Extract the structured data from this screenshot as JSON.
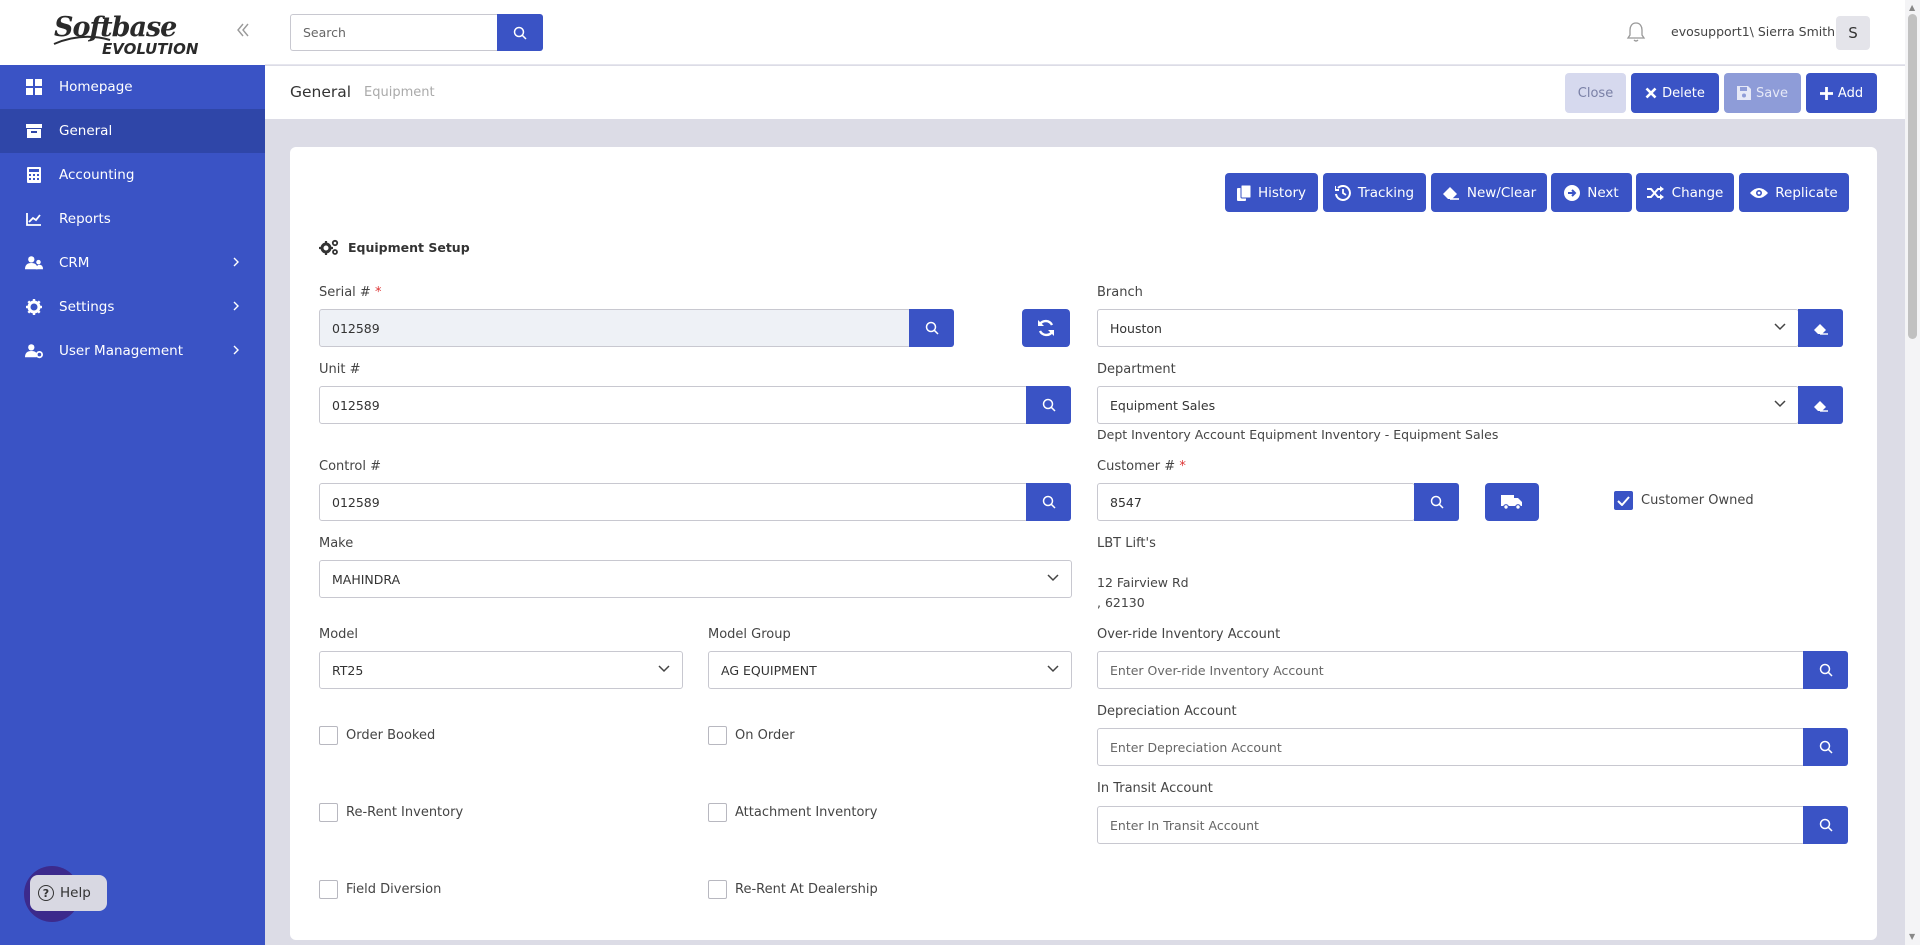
{
  "app": {
    "logo_line1": "Softbase",
    "logo_line2": "EVOLUTION"
  },
  "sidebar": {
    "items": [
      {
        "label": "Homepage",
        "icon": "grid-icon",
        "active": false
      },
      {
        "label": "General",
        "icon": "archive-icon",
        "active": true
      },
      {
        "label": "Accounting",
        "icon": "calculator-icon",
        "active": false
      },
      {
        "label": "Reports",
        "icon": "chart-icon",
        "active": false
      },
      {
        "label": "CRM",
        "icon": "users-icon",
        "active": false,
        "expandable": true
      },
      {
        "label": "Settings",
        "icon": "gear-icon",
        "active": false,
        "expandable": true
      },
      {
        "label": "User Management",
        "icon": "user-gear-icon",
        "active": false,
        "expandable": true
      }
    ],
    "help_label": "Help"
  },
  "topbar": {
    "search_placeholder": "Search",
    "username": "evosupport1\\ Sierra Smith",
    "avatar_initial": "S"
  },
  "breadcrumb": {
    "section": "General",
    "page": "Equipment"
  },
  "header_buttons": {
    "close": "Close",
    "delete": "Delete",
    "save": "Save",
    "add": "Add"
  },
  "actions": {
    "history": "History",
    "tracking": "Tracking",
    "new_clear": "New/Clear",
    "next": "Next",
    "change": "Change",
    "replicate": "Replicate"
  },
  "form": {
    "section_title": "Equipment Setup",
    "serial_label": "Serial #",
    "serial_value": "012589",
    "unit_label": "Unit #",
    "unit_value": "012589",
    "control_label": "Control #",
    "control_value": "012589",
    "make_label": "Make",
    "make_value": "MAHINDRA",
    "model_label": "Model",
    "model_value": "RT25",
    "model_group_label": "Model Group",
    "model_group_value": "AG EQUIPMENT",
    "branch_label": "Branch",
    "branch_value": "Houston",
    "department_label": "Department",
    "department_value": "Equipment Sales",
    "dept_inventory_text": "Dept Inventory Account Equipment Inventory - Equipment Sales",
    "customer_label": "Customer #",
    "customer_value": "8547",
    "customer_owned_label": "Customer Owned",
    "customer_owned": true,
    "customer_name": "LBT Lift's",
    "customer_address1": "12 Fairview Rd",
    "customer_address2": ", 62130",
    "override_label": "Over-ride Inventory Account",
    "override_placeholder": "Enter Over-ride Inventory Account",
    "depreciation_label": "Depreciation Account",
    "depreciation_placeholder": "Enter Depreciation Account",
    "transit_label": "In Transit Account",
    "transit_placeholder": "Enter In Transit Account",
    "checkboxes": {
      "order_booked": "Order Booked",
      "on_order": "On Order",
      "re_rent_inventory": "Re-Rent Inventory",
      "attachment_inventory": "Attachment Inventory",
      "field_diversion": "Field Diversion",
      "re_rent_dealership": "Re-Rent At Dealership"
    }
  },
  "colors": {
    "primary": "#3a53c5",
    "sidebar_active": "#2f46a8",
    "background": "#dcdce6"
  }
}
